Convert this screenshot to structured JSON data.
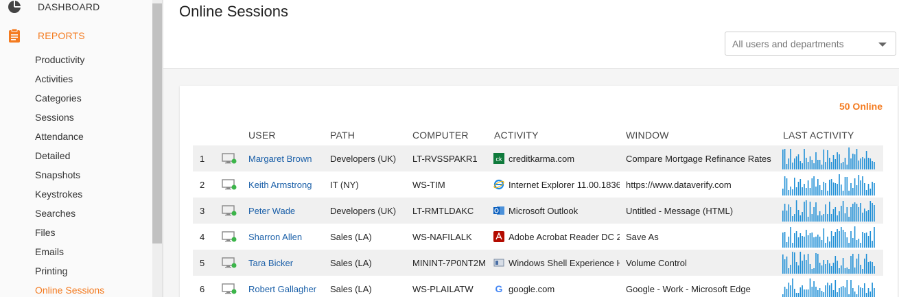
{
  "sidebar": {
    "dashboard": "DASHBOARD",
    "reports": "REPORTS",
    "items": [
      {
        "label": "Productivity"
      },
      {
        "label": "Activities"
      },
      {
        "label": "Categories"
      },
      {
        "label": "Sessions"
      },
      {
        "label": "Attendance"
      },
      {
        "label": "Detailed"
      },
      {
        "label": "Snapshots"
      },
      {
        "label": "Keystrokes"
      },
      {
        "label": "Searches"
      },
      {
        "label": "Files"
      },
      {
        "label": "Emails"
      },
      {
        "label": "Printing"
      },
      {
        "label": "Online Sessions"
      }
    ]
  },
  "header": {
    "title": "Online Sessions",
    "filter_value": "All users and departments"
  },
  "table": {
    "online": "50 Online",
    "columns": {
      "user": "USER",
      "path": "PATH",
      "computer": "COMPUTER",
      "activity": "ACTIVITY",
      "window": "WINDOW",
      "last": "LAST ACTIVITY"
    },
    "rows": [
      {
        "num": "1",
        "user": "Margaret Brown",
        "path": "Developers (UK)",
        "computer": "LT-RVSSPAKR1",
        "activity": "creditkarma.com",
        "icon": "creditkarma-icon",
        "window": "Compare Mortgage Refinance Rates"
      },
      {
        "num": "2",
        "user": "Keith Armstrong",
        "path": "IT (NY)",
        "computer": "WS-TIM",
        "activity": "Internet Explorer 11.00.1836",
        "icon": "internet-explorer-icon",
        "window": "https://www.dataverify.com"
      },
      {
        "num": "3",
        "user": "Peter Wade",
        "path": "Developers (UK)",
        "computer": "LT-RMTLDAKC",
        "activity": "Microsoft Outlook",
        "icon": "outlook-icon",
        "window": "Untitled - Message (HTML)"
      },
      {
        "num": "4",
        "user": "Sharron Allen",
        "path": "Sales (LA)",
        "computer": "WS-NAFILALK",
        "activity": "Adobe Acrobat Reader DC 2",
        "icon": "acrobat-icon",
        "window": "Save As"
      },
      {
        "num": "5",
        "user": "Tara Bicker",
        "path": "Sales (LA)",
        "computer": "MININT-7P0NT2M",
        "activity": "Windows Shell Experience H",
        "icon": "windows-shell-icon",
        "window": "Volume Control"
      },
      {
        "num": "6",
        "user": "Robert Gallagher",
        "path": "Sales (LA)",
        "computer": "WS-PLAILATW",
        "activity": "google.com",
        "icon": "google-icon",
        "window": "Google - Work - Microsoft Edge"
      }
    ]
  },
  "colors": {
    "accent": "#f47b20",
    "link": "#1a5fa8",
    "bar": "#1f8fd6",
    "online_dot": "#3cb54a"
  }
}
